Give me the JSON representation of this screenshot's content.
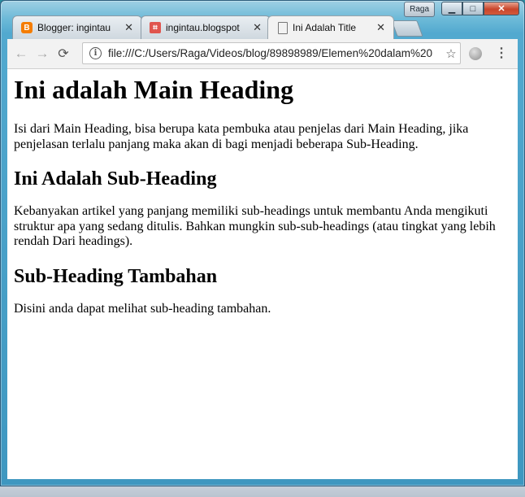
{
  "window": {
    "user": "Raga",
    "controls": {
      "minimize": "▁",
      "maximize": "□",
      "close": "✕"
    }
  },
  "tabs": [
    {
      "title": "Blogger: ingintau",
      "active": false
    },
    {
      "title": "ingintau.blogspot",
      "active": false
    },
    {
      "title": "Ini Adalah Title",
      "active": true
    }
  ],
  "toolbar": {
    "back": "←",
    "forward": "→",
    "reload": "⟳",
    "url": "file:///C:/Users/Raga/Videos/blog/89898989/Elemen%20dalam%20",
    "star": "☆",
    "menu": "⋮"
  },
  "content": {
    "main_heading": "Ini adalah Main Heading",
    "intro": "Isi dari Main Heading, bisa berupa kata pembuka atau penjelas dari Main Heading, jika penjelasan terlalu panjang maka akan di bagi menjadi beberapa Sub-Heading.",
    "sub_heading_1": "Ini Adalah Sub-Heading",
    "sub_text_1": "Kebanyakan artikel yang panjang memiliki sub-headings untuk membantu Anda mengikuti struktur apa yang sedang ditulis. Bahkan mungkin sub-sub-headings (atau tingkat yang lebih rendah Dari headings).",
    "sub_heading_2": "Sub-Heading Tambahan",
    "sub_text_2": "Disini anda dapat melihat sub-heading tambahan."
  },
  "colors": {
    "blogger": "#f57d00",
    "blogspot": "#e0554e"
  }
}
